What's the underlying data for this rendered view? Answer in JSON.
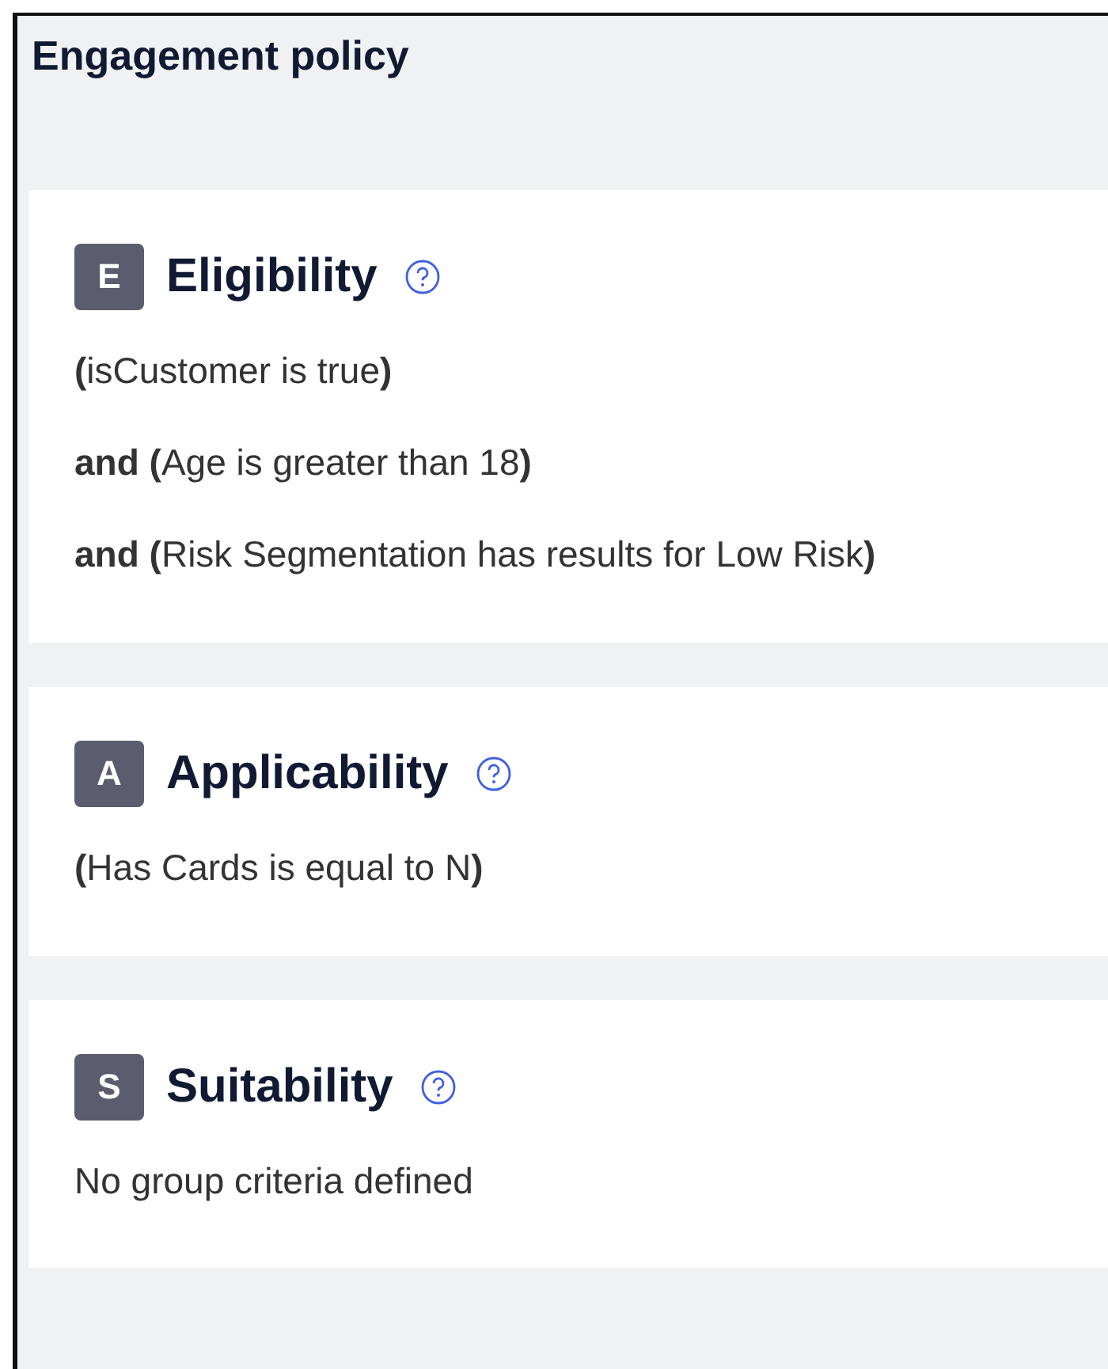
{
  "title": "Engagement policy",
  "sections": [
    {
      "letter": "E",
      "name": "Eligibility",
      "lines": [
        "**(**isCustomer is true**)**",
        "**and (**Age is greater than 18**)**",
        "**and (**Risk Segmentation has results for Low Risk**)**"
      ]
    },
    {
      "letter": "A",
      "name": "Applicability",
      "lines": [
        "**(**Has Cards is equal to N**)**"
      ]
    },
    {
      "letter": "S",
      "name": "Suitability",
      "lines": [
        "No group criteria defined"
      ]
    }
  ]
}
